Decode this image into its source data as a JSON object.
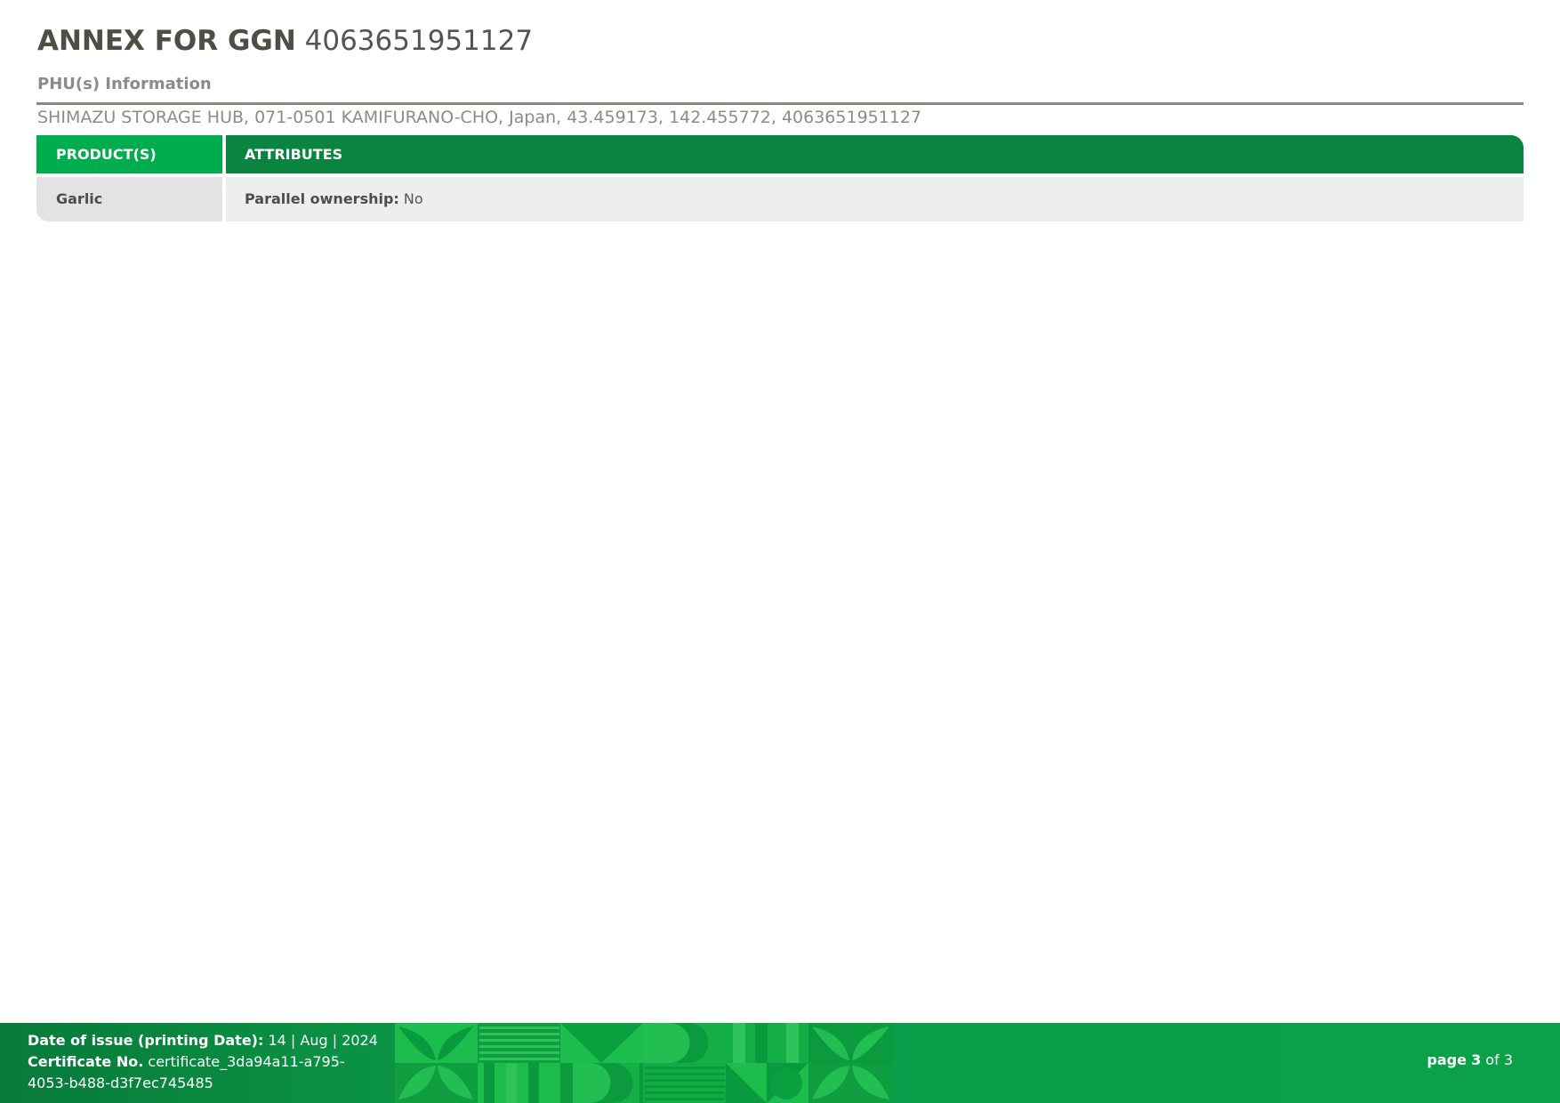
{
  "header": {
    "title_bold": "ANNEX FOR GGN",
    "title_number": "4063651951127",
    "subheading": "PHU(s) Information",
    "address": "SHIMAZU STORAGE HUB,  071-0501 KAMIFURANO-CHO, Japan, 43.459173, 142.455772, 4063651951127"
  },
  "table": {
    "columns": [
      "PRODUCT(S)",
      "ATTRIBUTES"
    ],
    "rows": [
      {
        "product": "Garlic",
        "attr_key": "Parallel ownership:",
        "attr_value": "No"
      }
    ]
  },
  "footer": {
    "date_label": "Date of issue (printing Date):",
    "date_value": "14 | Aug | 2024",
    "cert_label": "Certificate No.",
    "cert_value": "certificate_3da94a11-a795-4053-b488-d3f7ec745485",
    "page_label": "page",
    "page_current": "3",
    "page_of": "of",
    "page_total": "3"
  },
  "colors": {
    "green_light": "#00ad4e",
    "green_dark": "#0b8440",
    "text_dark": "#4e4e46",
    "text_grey": "#8c8c86"
  }
}
